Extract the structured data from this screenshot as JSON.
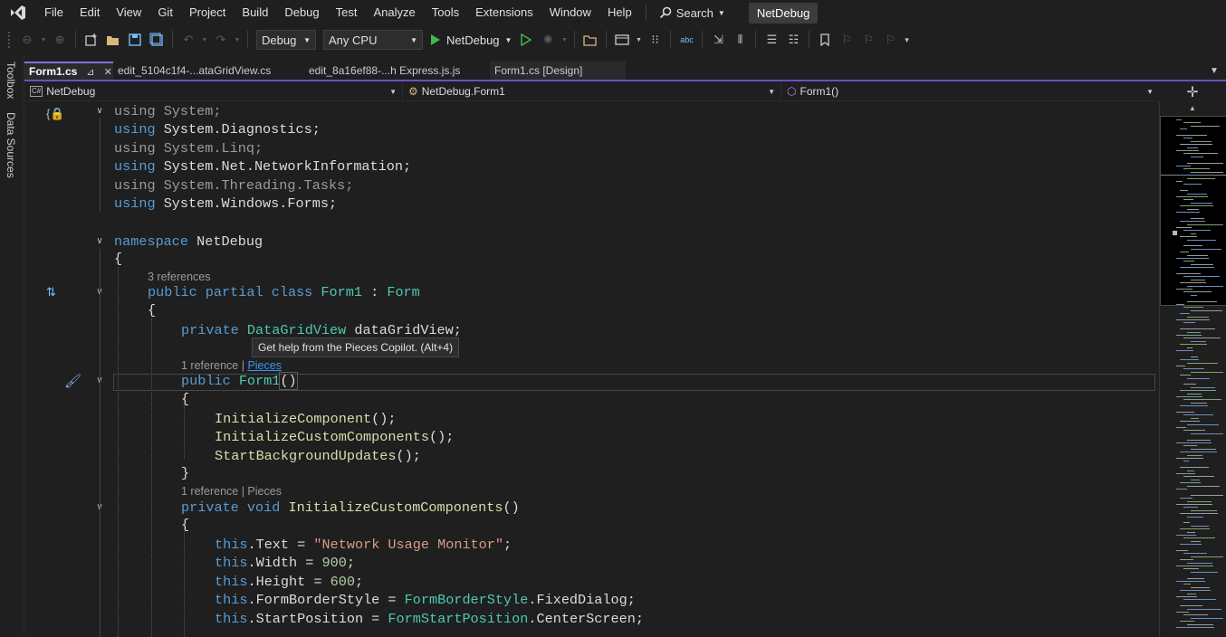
{
  "menu": {
    "items": [
      "File",
      "Edit",
      "View",
      "Git",
      "Project",
      "Build",
      "Debug",
      "Test",
      "Analyze",
      "Tools",
      "Extensions",
      "Window",
      "Help"
    ],
    "search_label": "Search",
    "solution_name": "NetDebug"
  },
  "toolbar": {
    "configuration": "Debug",
    "platform": "Any CPU",
    "run_target": "NetDebug"
  },
  "sidebar": {
    "toolbox_label": "Toolbox",
    "data_sources_label": "Data Sources"
  },
  "tabs": [
    {
      "label": "Form1.cs",
      "active": true
    },
    {
      "label": "edit_5104c1f4-...ataGridView.cs",
      "active": false
    },
    {
      "label": "edit_8a16ef88-...h Express.js.js",
      "active": false
    },
    {
      "label": "Form1.cs [Design]",
      "active": false
    }
  ],
  "navbar": {
    "project": "NetDebug",
    "type": "NetDebug.Form1",
    "member": "Form1()"
  },
  "codelens": {
    "class_refs": "3 references",
    "ctor_refs": "1 reference",
    "ctor_sep": " | ",
    "ctor_link": "Pieces",
    "method_refs": "1 reference | Pieces"
  },
  "tooltip": "Get help from the Pieces Copilot. (Alt+4)",
  "code": {
    "u1a": "using",
    "u1b": " System;",
    "u2a": "using",
    "u2b": " System.Diagnostics;",
    "u3a": "using",
    "u3b": " System.Linq;",
    "u4a": "using",
    "u4b": " System.Net.NetworkInformation;",
    "u5a": "using",
    "u5b": " System.Threading.Tasks;",
    "u6a": "using",
    "u6b": " System.Windows.Forms;",
    "ns_kw": "namespace",
    "ns_name": " NetDebug",
    "brace_open": "{",
    "brace_close": "}",
    "cls_kw": "public partial class ",
    "cls_name": "Form1",
    "cls_sep": " : ",
    "cls_base": "Form",
    "fld_kw": "private ",
    "fld_type": "DataGridView",
    "fld_name": " dataGridView;",
    "ctor_kw": "public ",
    "ctor_name": "Form1",
    "ctor_parens": "()",
    "call1": "InitializeComponent",
    "call2": "InitializeCustomComponents",
    "call3": "StartBackgroundUpdates",
    "call_end": "();",
    "m_kw": "private void ",
    "m_name": "InitializeCustomComponents",
    "m_parens": "()",
    "this": "this",
    "p1": ".Text = ",
    "p1v": "\"Network Usage Monitor\"",
    "semi": ";",
    "p2": ".Width = ",
    "p2v": "900",
    "p3": ".Height = ",
    "p3v": "600",
    "p4": ".FormBorderStyle = ",
    "p4t": "FormBorderStyle",
    "p4v": ".FixedDialog;",
    "p5": ".StartPosition = ",
    "p5t": "FormStartPosition",
    "p5v": ".CenterScreen;"
  },
  "colors": {
    "keyword": "#569cd6",
    "type": "#4ec9b0",
    "method": "#dcdcaa",
    "string": "#d69d85",
    "number": "#b5cea8",
    "accent": "#6d4ec5"
  }
}
